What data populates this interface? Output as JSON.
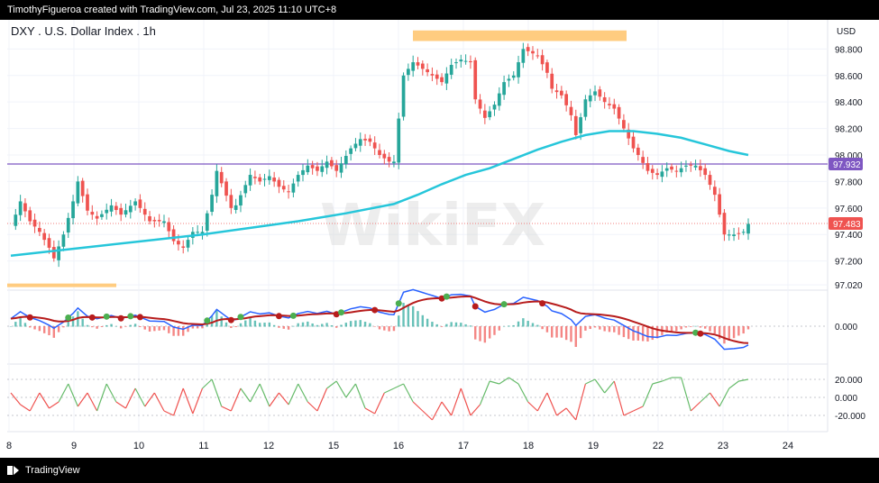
{
  "header": {
    "caption": "TimothyFigueroa created with TradingView.com, Jul 23, 2025 11:10 UTC+8"
  },
  "footer": {
    "brand": "TradingView"
  },
  "watermark": "WikiFX",
  "chart_data": {
    "type": "candlestick",
    "title": "DXY . U.S. Dollar Index . 1h",
    "currency": "USD",
    "x_ticks": [
      "8",
      "9",
      "10",
      "11",
      "12",
      "15",
      "16",
      "17",
      "18",
      "19",
      "22",
      "23",
      "24"
    ],
    "price_axis": {
      "ticks": [
        "97.020",
        "97.200",
        "97.400",
        "97.600",
        "97.800",
        "98.000",
        "98.200",
        "98.400",
        "98.600",
        "98.800"
      ],
      "range": [
        96.98,
        99.02
      ],
      "horizontal_line": {
        "label": "97.932",
        "value": 97.932,
        "color": "#7e57c2"
      },
      "last_price": {
        "label": "97.483",
        "value": 97.483,
        "color": "#ef5350"
      },
      "resistance_zone": {
        "from": 98.86,
        "to": 98.94,
        "color": "#ffcc80"
      },
      "support_zone": {
        "from": 97.0,
        "to": 97.03,
        "color": "#ffcc80"
      },
      "moving_average_color": "#26c6da",
      "candle_up_color": "#26a69a",
      "candle_down_color": "#ef5350"
    },
    "macd": {
      "ticks": [
        "0.000"
      ],
      "zero": 0
    },
    "oscillator": {
      "ticks": [
        "20.000",
        "0.000",
        "-20.000"
      ],
      "range": [
        -30,
        30
      ]
    },
    "price_path": [
      [
        0,
        97.45
      ],
      [
        2,
        97.65
      ],
      [
        4,
        97.5
      ],
      [
        6,
        97.42
      ],
      [
        8,
        97.3
      ],
      [
        9,
        97.22
      ],
      [
        11,
        97.4
      ],
      [
        13,
        97.65
      ],
      [
        14,
        97.8
      ],
      [
        16,
        97.58
      ],
      [
        18,
        97.52
      ],
      [
        21,
        97.62
      ],
      [
        23,
        97.55
      ],
      [
        26,
        97.65
      ],
      [
        29,
        97.5
      ],
      [
        32,
        97.5
      ],
      [
        34,
        97.35
      ],
      [
        36,
        97.3
      ],
      [
        38,
        97.42
      ],
      [
        40,
        97.42
      ],
      [
        42,
        97.7
      ],
      [
        43,
        97.88
      ],
      [
        46,
        97.6
      ],
      [
        47,
        97.62
      ],
      [
        50,
        97.85
      ],
      [
        52,
        97.8
      ],
      [
        54,
        97.84
      ],
      [
        56,
        97.76
      ],
      [
        58,
        97.72
      ],
      [
        60,
        97.85
      ],
      [
        62,
        97.92
      ],
      [
        64,
        97.88
      ],
      [
        66,
        97.95
      ],
      [
        68,
        97.88
      ],
      [
        71,
        98.05
      ],
      [
        73,
        98.12
      ],
      [
        75,
        98.1
      ],
      [
        77,
        98.0
      ],
      [
        79,
        97.95
      ],
      [
        80,
        97.95
      ],
      [
        82,
        98.6
      ],
      [
        84,
        98.7
      ],
      [
        86,
        98.65
      ],
      [
        88,
        98.6
      ],
      [
        90,
        98.55
      ],
      [
        92,
        98.68
      ],
      [
        94,
        98.72
      ],
      [
        96,
        98.7
      ],
      [
        97,
        98.42
      ],
      [
        99,
        98.28
      ],
      [
        101,
        98.38
      ],
      [
        103,
        98.55
      ],
      [
        105,
        98.6
      ],
      [
        106,
        98.7
      ],
      [
        107,
        98.8
      ],
      [
        110,
        98.75
      ],
      [
        112,
        98.62
      ],
      [
        113,
        98.5
      ],
      [
        115,
        98.45
      ],
      [
        117,
        98.3
      ],
      [
        118,
        98.15
      ],
      [
        120,
        98.42
      ],
      [
        122,
        98.48
      ],
      [
        124,
        98.4
      ],
      [
        126,
        98.35
      ],
      [
        128,
        98.2
      ],
      [
        130,
        98.05
      ],
      [
        131,
        98.0
      ],
      [
        133,
        97.88
      ],
      [
        135,
        97.85
      ],
      [
        137,
        97.9
      ],
      [
        139,
        97.88
      ],
      [
        141,
        97.92
      ],
      [
        143,
        97.92
      ],
      [
        145,
        97.85
      ],
      [
        147,
        97.7
      ],
      [
        148,
        97.55
      ],
      [
        149,
        97.4
      ],
      [
        151,
        97.4
      ],
      [
        153,
        97.42
      ],
      [
        154,
        97.48
      ]
    ],
    "ma_path": [
      [
        0,
        97.24
      ],
      [
        10,
        97.28
      ],
      [
        20,
        97.32
      ],
      [
        30,
        97.36
      ],
      [
        40,
        97.4
      ],
      [
        50,
        97.45
      ],
      [
        60,
        97.5
      ],
      [
        70,
        97.56
      ],
      [
        80,
        97.63
      ],
      [
        85,
        97.7
      ],
      [
        90,
        97.78
      ],
      [
        95,
        97.85
      ],
      [
        100,
        97.9
      ],
      [
        105,
        97.97
      ],
      [
        110,
        98.04
      ],
      [
        115,
        98.1
      ],
      [
        120,
        98.15
      ],
      [
        125,
        98.18
      ],
      [
        130,
        98.18
      ],
      [
        135,
        98.16
      ],
      [
        140,
        98.13
      ],
      [
        145,
        98.08
      ],
      [
        150,
        98.03
      ],
      [
        154,
        98.0
      ]
    ],
    "oscillator_path": [
      [
        0,
        5
      ],
      [
        2,
        -8
      ],
      [
        4,
        -15
      ],
      [
        6,
        5
      ],
      [
        8,
        -12
      ],
      [
        10,
        -5
      ],
      [
        12,
        15
      ],
      [
        14,
        -10
      ],
      [
        16,
        5
      ],
      [
        18,
        -15
      ],
      [
        20,
        15
      ],
      [
        22,
        -5
      ],
      [
        24,
        -12
      ],
      [
        26,
        10
      ],
      [
        28,
        -10
      ],
      [
        30,
        5
      ],
      [
        32,
        -15
      ],
      [
        34,
        -20
      ],
      [
        36,
        10
      ],
      [
        38,
        -18
      ],
      [
        40,
        10
      ],
      [
        42,
        20
      ],
      [
        44,
        -10
      ],
      [
        46,
        -15
      ],
      [
        48,
        10
      ],
      [
        50,
        -5
      ],
      [
        52,
        15
      ],
      [
        54,
        -10
      ],
      [
        56,
        5
      ],
      [
        58,
        -8
      ],
      [
        60,
        15
      ],
      [
        62,
        -5
      ],
      [
        64,
        -15
      ],
      [
        66,
        10
      ],
      [
        68,
        18
      ],
      [
        70,
        0
      ],
      [
        72,
        15
      ],
      [
        74,
        -12
      ],
      [
        76,
        -18
      ],
      [
        78,
        5
      ],
      [
        80,
        10
      ],
      [
        82,
        15
      ],
      [
        84,
        -5
      ],
      [
        86,
        -15
      ],
      [
        88,
        -25
      ],
      [
        90,
        -5
      ],
      [
        92,
        -20
      ],
      [
        94,
        10
      ],
      [
        96,
        -20
      ],
      [
        98,
        -8
      ],
      [
        100,
        18
      ],
      [
        102,
        15
      ],
      [
        104,
        22
      ],
      [
        106,
        15
      ],
      [
        108,
        -5
      ],
      [
        110,
        -15
      ],
      [
        112,
        5
      ],
      [
        114,
        -20
      ],
      [
        116,
        -12
      ],
      [
        118,
        -25
      ],
      [
        120,
        15
      ],
      [
        122,
        20
      ],
      [
        124,
        5
      ],
      [
        126,
        18
      ],
      [
        128,
        -20
      ],
      [
        130,
        -15
      ],
      [
        132,
        -10
      ],
      [
        134,
        15
      ],
      [
        136,
        18
      ],
      [
        138,
        22
      ],
      [
        140,
        22
      ],
      [
        142,
        -15
      ],
      [
        144,
        -5
      ],
      [
        146,
        5
      ],
      [
        148,
        -10
      ],
      [
        150,
        10
      ],
      [
        152,
        18
      ],
      [
        154,
        20
      ]
    ]
  }
}
